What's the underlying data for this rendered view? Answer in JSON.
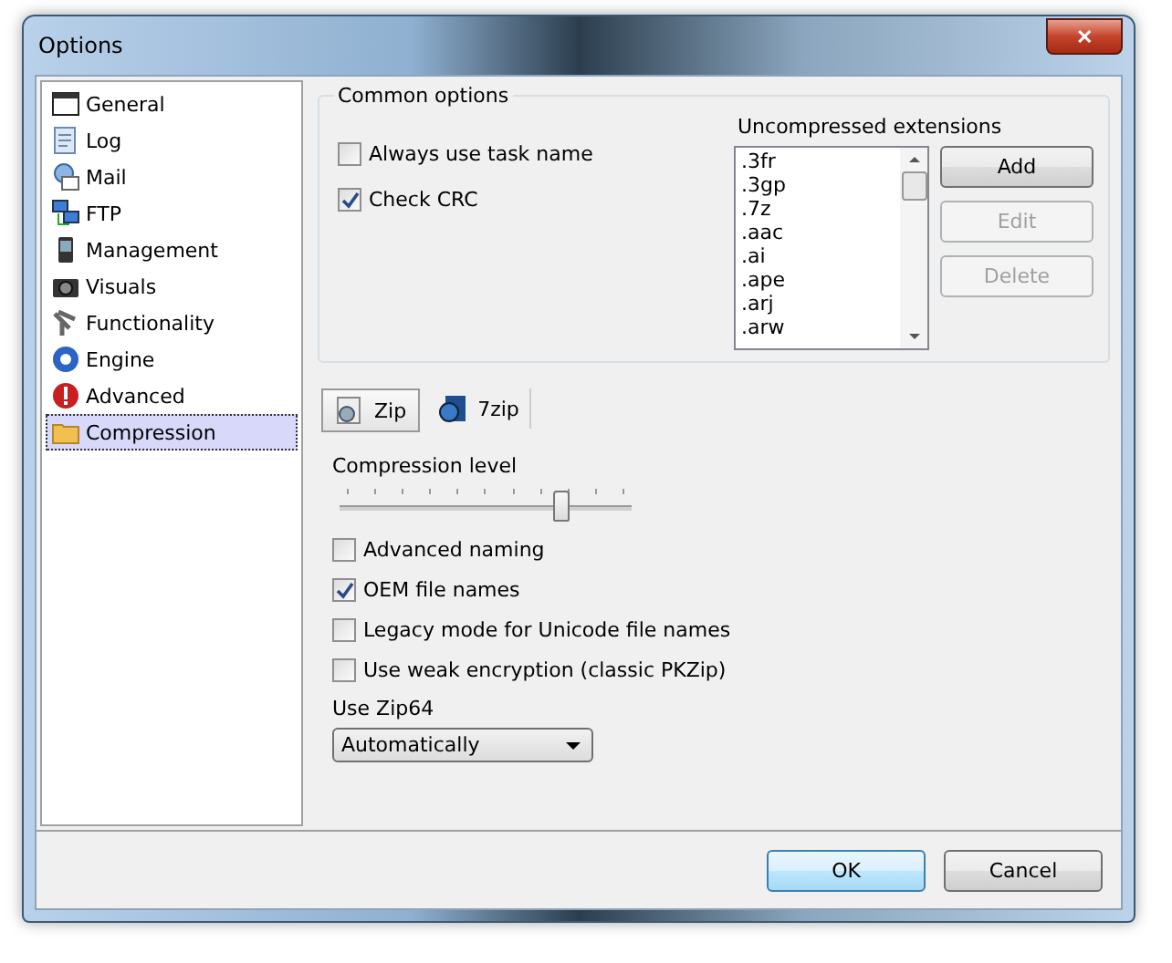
{
  "window": {
    "title": "Options",
    "close": "✕"
  },
  "sidebar": {
    "items": [
      {
        "label": "General",
        "selected": false
      },
      {
        "label": "Log",
        "selected": false
      },
      {
        "label": "Mail",
        "selected": false
      },
      {
        "label": "FTP",
        "selected": false
      },
      {
        "label": "Management",
        "selected": false
      },
      {
        "label": "Visuals",
        "selected": false
      },
      {
        "label": "Functionality",
        "selected": false
      },
      {
        "label": "Engine",
        "selected": false
      },
      {
        "label": "Advanced",
        "selected": false
      },
      {
        "label": "Compression",
        "selected": true
      }
    ]
  },
  "common_options": {
    "title": "Common options",
    "checkboxes": [
      {
        "label": "Always use task name",
        "checked": false
      },
      {
        "label": "Check CRC",
        "checked": true
      }
    ],
    "extensions_label": "Uncompressed extensions",
    "extensions": [
      ".3fr",
      ".3gp",
      ".7z",
      ".aac",
      ".ai",
      ".ape",
      ".arj",
      ".arw"
    ],
    "buttons": [
      {
        "label": "Add",
        "disabled": false
      },
      {
        "label": "Edit",
        "disabled": true
      },
      {
        "label": "Delete",
        "disabled": true
      }
    ]
  },
  "tabs": [
    {
      "label": "Zip",
      "selected": true
    },
    {
      "label": "7zip",
      "selected": false
    }
  ],
  "compression_level": {
    "label": "Compression level",
    "level": 0.76
  },
  "zip_options": [
    {
      "label": "Advanced naming",
      "checked": false
    },
    {
      "label": "OEM file names",
      "checked": true
    },
    {
      "label": "Legacy mode for Unicode file names",
      "checked": false
    },
    {
      "label": "Use weak encryption (classic PKZip)",
      "checked": false
    }
  ],
  "zip64": {
    "label": "Use Zip64",
    "value": "Automatically"
  },
  "buttons": [
    {
      "label": "OK",
      "default": true
    },
    {
      "label": "Cancel",
      "default": false
    }
  ]
}
